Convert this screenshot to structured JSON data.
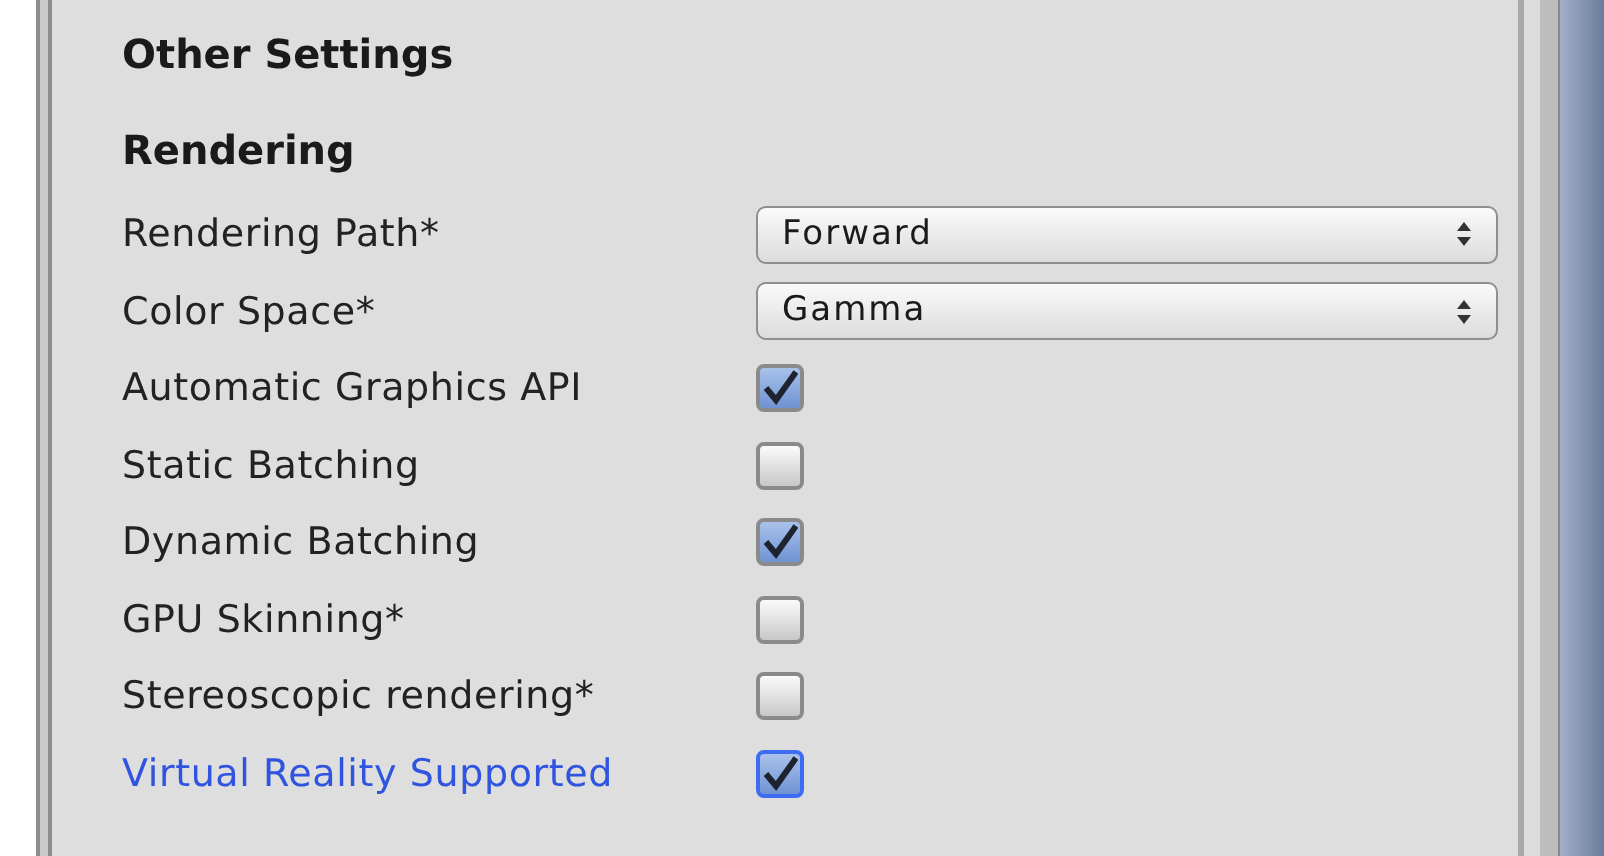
{
  "section_title": "Other Settings",
  "group_title": "Rendering",
  "rows": [
    {
      "kind": "dropdown",
      "label": "Rendering Path*",
      "value": "Forward",
      "focused": false
    },
    {
      "kind": "dropdown",
      "label": "Color Space*",
      "value": "Gamma",
      "focused": false
    },
    {
      "kind": "checkbox",
      "label": "Automatic Graphics API",
      "checked": true,
      "focused": false
    },
    {
      "kind": "checkbox",
      "label": "Static Batching",
      "checked": false,
      "focused": false
    },
    {
      "kind": "checkbox",
      "label": "Dynamic Batching",
      "checked": true,
      "focused": false
    },
    {
      "kind": "checkbox",
      "label": "GPU Skinning*",
      "checked": false,
      "focused": false
    },
    {
      "kind": "checkbox",
      "label": "Stereoscopic rendering*",
      "checked": false,
      "focused": false
    },
    {
      "kind": "checkbox",
      "label": "Virtual Reality Supported",
      "checked": true,
      "focused": true
    }
  ]
}
